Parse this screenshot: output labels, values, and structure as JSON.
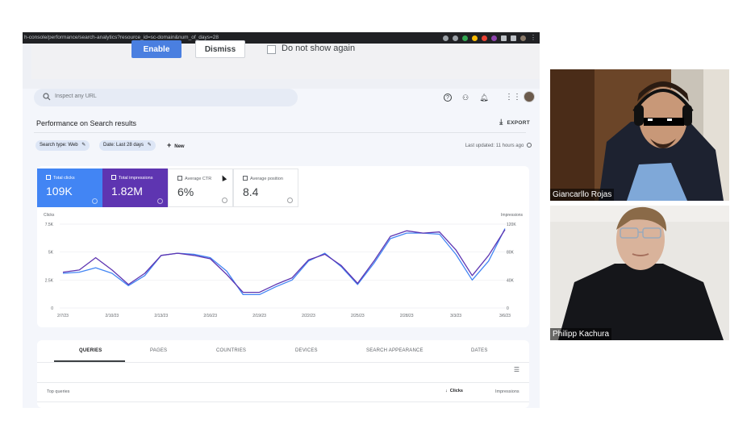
{
  "browser": {
    "url": "h-console/performance/search-analytics?resource_id=sc-domain&num_of_days=28"
  },
  "banner": {
    "enable_label": "Enable",
    "dismiss_label": "Dismiss",
    "do_not_show_label": "Do not show again"
  },
  "header": {
    "search_placeholder": "Inspect any URL"
  },
  "performance": {
    "title": "Performance on Search results",
    "export_label": "EXPORT",
    "filters": [
      "Search type: Web",
      "Date: Last 28 days"
    ],
    "new_label": "New",
    "last_updated": "Last updated: 11 hours ago"
  },
  "metrics": [
    {
      "label": "Total clicks",
      "value": "109K",
      "checked": true,
      "color": "#4285f4"
    },
    {
      "label": "Total impressions",
      "value": "1.82M",
      "checked": true,
      "color": "#5e35b1"
    },
    {
      "label": "Average CTR",
      "value": "6%",
      "checked": false
    },
    {
      "label": "Average position",
      "value": "8.4",
      "checked": false
    }
  ],
  "chart_data": {
    "type": "line",
    "left_axis_label": "Clicks",
    "right_axis_label": "Impressions",
    "left_ticks": [
      "7.5K",
      "5K",
      "2.5K",
      "0"
    ],
    "right_ticks": [
      "120K",
      "80K",
      "40K",
      "0"
    ],
    "ylim_left": [
      0,
      7500
    ],
    "ylim_right": [
      0,
      120000
    ],
    "x_tick_labels": [
      "2/7/23",
      "2/10/23",
      "2/13/23",
      "2/16/23",
      "2/19/23",
      "2/22/23",
      "2/25/23",
      "2/28/23",
      "3/3/23",
      "3/6/23"
    ],
    "x_count": 28,
    "series": [
      {
        "name": "Clicks",
        "axis": "left",
        "color": "#4285f4",
        "values": [
          3100,
          3200,
          3600,
          3100,
          2000,
          2900,
          4700,
          4900,
          4800,
          4500,
          3300,
          1200,
          1200,
          1900,
          2500,
          4200,
          4900,
          3700,
          2100,
          4000,
          6200,
          6700,
          6700,
          6600,
          4800,
          2500,
          4200,
          7100
        ]
      },
      {
        "name": "Impressions",
        "axis": "left",
        "color": "#5e35b1",
        "values": [
          3200,
          3400,
          4500,
          3400,
          2100,
          3100,
          4700,
          4900,
          4700,
          4400,
          3000,
          1400,
          1400,
          2100,
          2700,
          4300,
          4800,
          3800,
          2200,
          4200,
          6400,
          6900,
          6700,
          6800,
          5200,
          2900,
          4700,
          7000
        ]
      }
    ]
  },
  "tabs": [
    "QUERIES",
    "PAGES",
    "COUNTRIES",
    "DEVICES",
    "SEARCH APPEARANCE",
    "DATES"
  ],
  "table": {
    "title": "Top queries",
    "clicks_header": "Clicks",
    "impressions_header": "Impressions"
  },
  "participants": [
    {
      "name": "Giancarllo Rojas"
    },
    {
      "name": "Philipp Kachura"
    }
  ]
}
